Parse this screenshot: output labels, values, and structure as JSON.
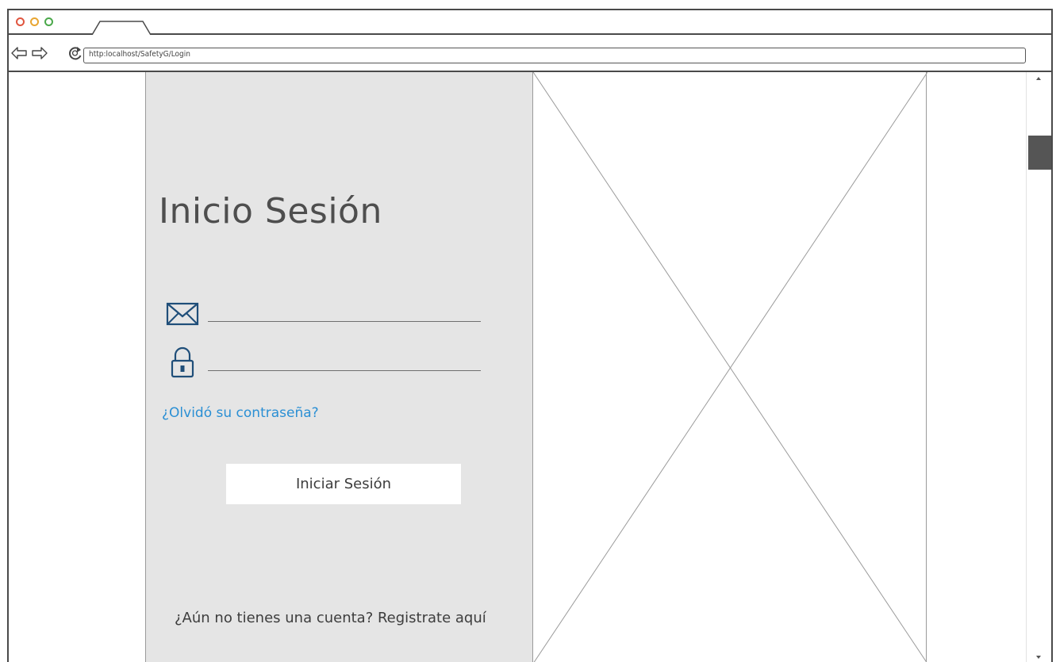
{
  "browser": {
    "url": "http:localhost/SafetyG/Login"
  },
  "login": {
    "title": "Inicio Sesión",
    "email_value": "",
    "password_value": "",
    "forgot_password": "¿Olvidó su contraseña?",
    "submit_label": "Iniciar Sesión",
    "register_prompt": "¿Aún no tienes una cuenta? Registrate aquí"
  },
  "icons": {
    "email": "envelope-icon",
    "password": "lock-icon",
    "back": "back-arrow-icon",
    "forward": "forward-arrow-icon",
    "reload": "reload-icon"
  },
  "colors": {
    "panel_bg": "#e5e5e5",
    "link": "#2a8fd4",
    "icon": "#1f4e79",
    "close_dot": "#e0553f",
    "minimize_dot": "#e8a531",
    "maximize_dot": "#4aa84a"
  }
}
